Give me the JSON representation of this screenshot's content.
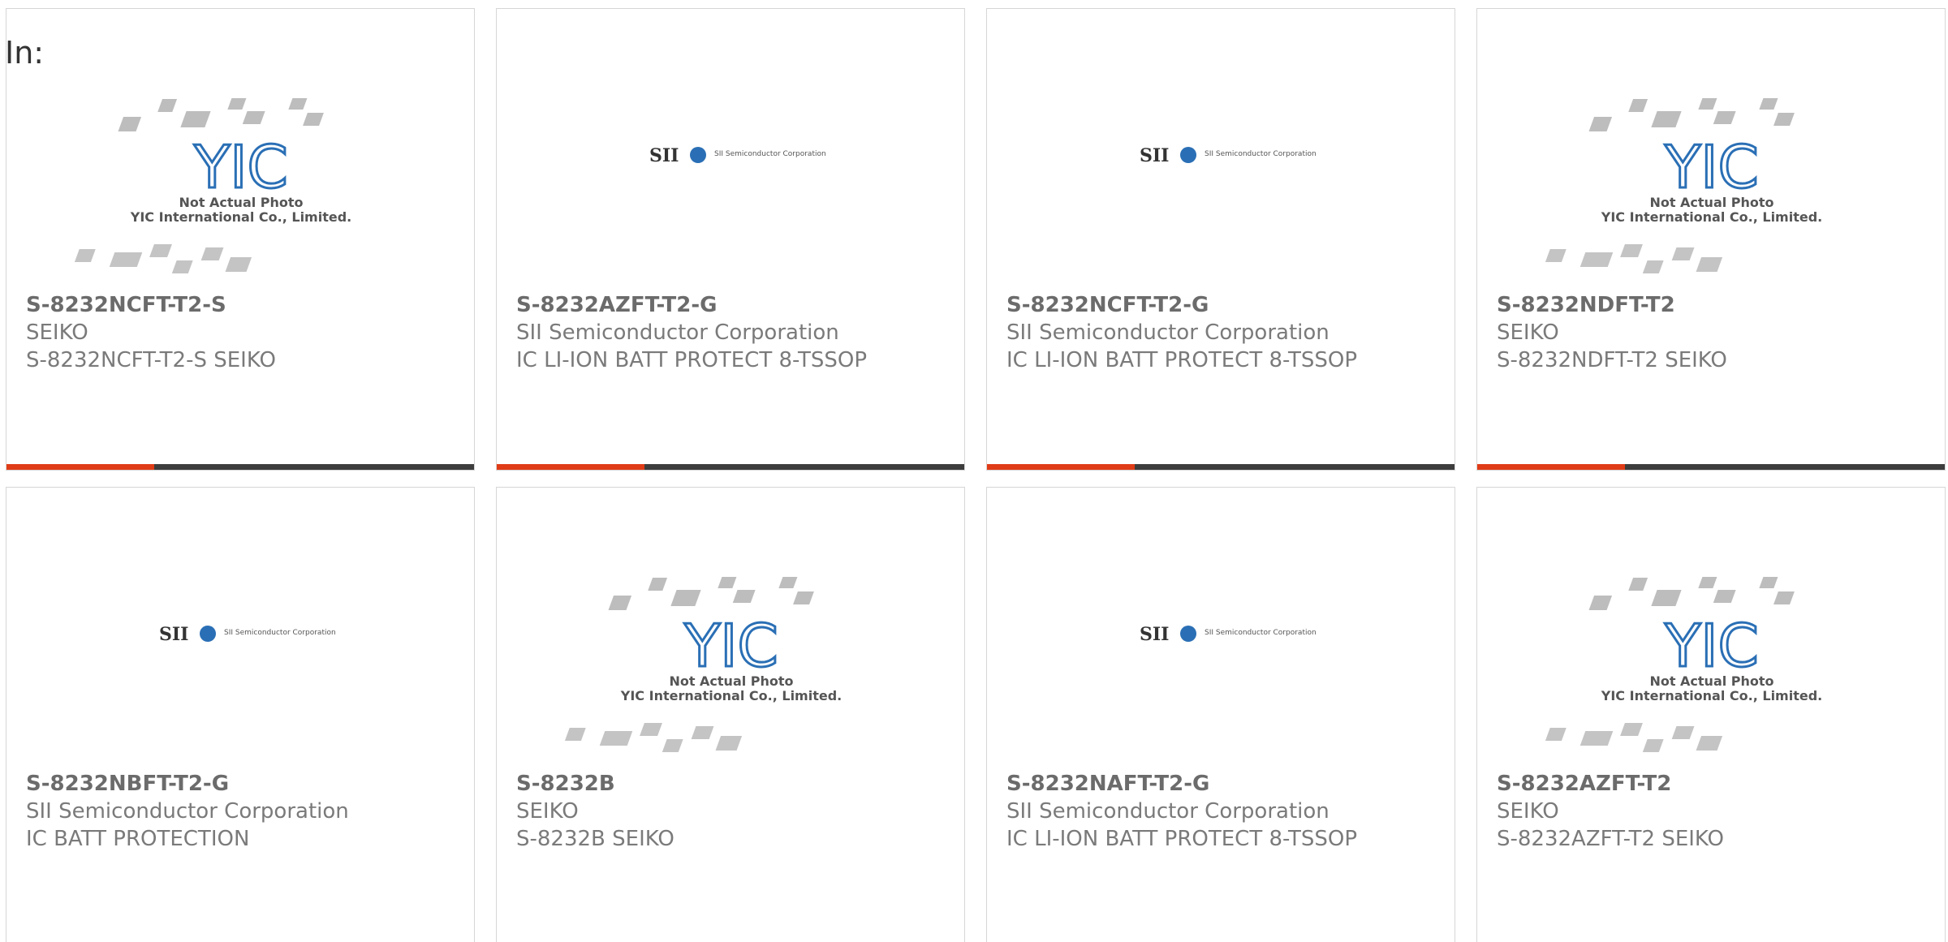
{
  "header": {
    "in_label": "In:"
  },
  "colors": {
    "accent": "#e03c17",
    "bar": "#3d3d3d",
    "border": "#d6d6d6",
    "text": "#7a7a7a"
  },
  "placeholders": {
    "yic": {
      "line1": "Not Actual Photo",
      "line2": "YIC International Co., Limited.",
      "logo": "YIC"
    },
    "sii": {
      "mark": "SII",
      "tagline": "SII Semiconductor Corporation"
    }
  },
  "cards": [
    {
      "part_number": "S-8232NCFT-T2-S",
      "manufacturer": "SEIKO",
      "description": "S-8232NCFT-T2-S SEIKO",
      "image": "yic"
    },
    {
      "part_number": "S-8232AZFT-T2-G",
      "manufacturer": "SII Semiconductor Corporation",
      "description": "IC LI-ION BATT PROTECT 8-TSSOP",
      "image": "sii"
    },
    {
      "part_number": "S-8232NCFT-T2-G",
      "manufacturer": "SII Semiconductor Corporation",
      "description": "IC LI-ION BATT PROTECT 8-TSSOP",
      "image": "sii"
    },
    {
      "part_number": "S-8232NDFT-T2",
      "manufacturer": "SEIKO",
      "description": "S-8232NDFT-T2 SEIKO",
      "image": "yic"
    },
    {
      "part_number": "S-8232NBFT-T2-G",
      "manufacturer": "SII Semiconductor Corporation",
      "description": "IC BATT PROTECTION",
      "image": "sii"
    },
    {
      "part_number": "S-8232B",
      "manufacturer": "SEIKO",
      "description": "S-8232B SEIKO",
      "image": "yic"
    },
    {
      "part_number": "S-8232NAFT-T2-G",
      "manufacturer": "SII Semiconductor Corporation",
      "description": "IC LI-ION BATT PROTECT 8-TSSOP",
      "image": "sii"
    },
    {
      "part_number": "S-8232AZFT-T2",
      "manufacturer": "SEIKO",
      "description": "S-8232AZFT-T2 SEIKO",
      "image": "yic"
    }
  ]
}
